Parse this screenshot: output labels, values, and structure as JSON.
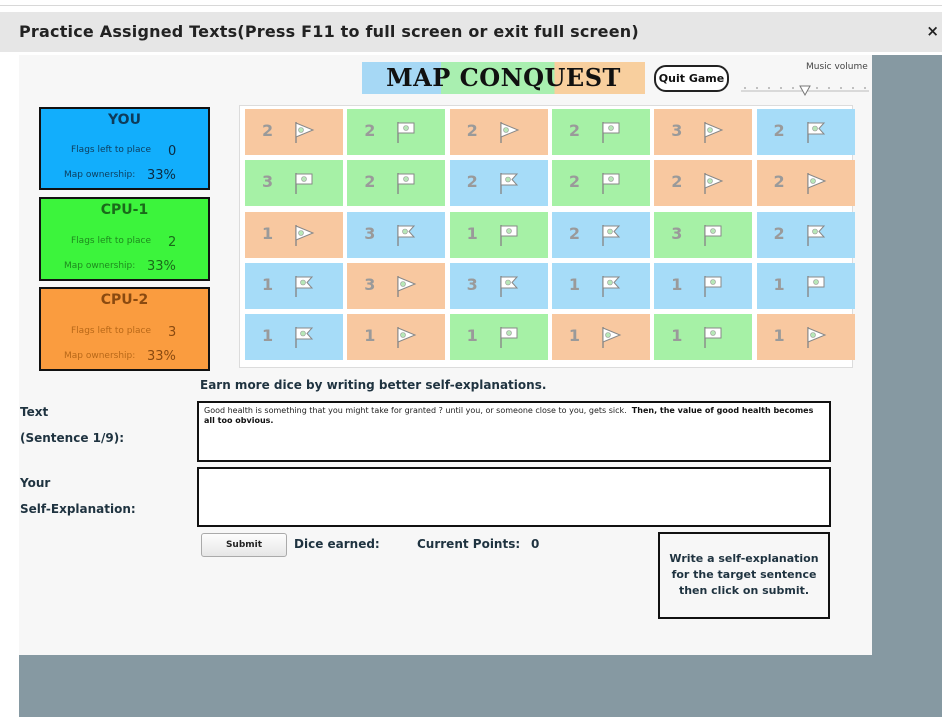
{
  "window": {
    "title": "Practice Assigned Texts(Press F11 to full screen or exit full screen)",
    "close_label": "×"
  },
  "header": {
    "logo_text": "MAP CONQUEST",
    "quit_label": "Quit Game",
    "music_label": "Music volume",
    "music_level": 0.5
  },
  "players": [
    {
      "name": "YOU",
      "flags_label": "Flags left to place",
      "flags": "0",
      "ownership_label": "Map ownership:",
      "ownership": "33%"
    },
    {
      "name": "CPU-1",
      "flags_label": "Flags left to place",
      "flags": "2",
      "ownership_label": "Map ownership:",
      "ownership": "33%"
    },
    {
      "name": "CPU-2",
      "flags_label": "Flags left to place",
      "flags": "3",
      "ownership_label": "Map ownership:",
      "ownership": "33%"
    }
  ],
  "colors": {
    "you": "#12aefc",
    "cpu1": "#3cf43c",
    "cpu2": "#fa9c3f",
    "tile_you": "#a6dcf8",
    "tile_cpu1": "#a6f1a6",
    "tile_cpu2": "#f8c8a0"
  },
  "map": {
    "rows": [
      [
        {
          "owner": "cpu2",
          "dice": "2",
          "flag": "pennant"
        },
        {
          "owner": "cpu1",
          "dice": "2",
          "flag": "square"
        },
        {
          "owner": "cpu2",
          "dice": "2",
          "flag": "pennant"
        },
        {
          "owner": "cpu1",
          "dice": "2",
          "flag": "square"
        },
        {
          "owner": "cpu2",
          "dice": "3",
          "flag": "pennant"
        },
        {
          "owner": "you",
          "dice": "2",
          "flag": "swallowtail"
        }
      ],
      [
        {
          "owner": "cpu1",
          "dice": "3",
          "flag": "square"
        },
        {
          "owner": "cpu1",
          "dice": "2",
          "flag": "square"
        },
        {
          "owner": "you",
          "dice": "2",
          "flag": "swallowtail"
        },
        {
          "owner": "cpu1",
          "dice": "2",
          "flag": "square"
        },
        {
          "owner": "cpu2",
          "dice": "2",
          "flag": "pennant"
        },
        {
          "owner": "cpu2",
          "dice": "2",
          "flag": "pennant"
        }
      ],
      [
        {
          "owner": "cpu2",
          "dice": "1",
          "flag": "pennant"
        },
        {
          "owner": "you",
          "dice": "3",
          "flag": "swallowtail"
        },
        {
          "owner": "cpu1",
          "dice": "1",
          "flag": "square"
        },
        {
          "owner": "you",
          "dice": "2",
          "flag": "swallowtail"
        },
        {
          "owner": "cpu1",
          "dice": "3",
          "flag": "square"
        },
        {
          "owner": "you",
          "dice": "2",
          "flag": "swallowtail"
        }
      ],
      [
        {
          "owner": "you",
          "dice": "1",
          "flag": "swallowtail"
        },
        {
          "owner": "cpu2",
          "dice": "3",
          "flag": "pennant"
        },
        {
          "owner": "you",
          "dice": "3",
          "flag": "swallowtail"
        },
        {
          "owner": "you",
          "dice": "1",
          "flag": "swallowtail"
        },
        {
          "owner": "you",
          "dice": "1",
          "flag": "square"
        },
        {
          "owner": "you",
          "dice": "1",
          "flag": "square"
        }
      ],
      [
        {
          "owner": "you",
          "dice": "1",
          "flag": "swallowtail"
        },
        {
          "owner": "cpu2",
          "dice": "1",
          "flag": "pennant"
        },
        {
          "owner": "cpu1",
          "dice": "1",
          "flag": "square"
        },
        {
          "owner": "cpu2",
          "dice": "1",
          "flag": "pennant"
        },
        {
          "owner": "cpu1",
          "dice": "1",
          "flag": "square"
        },
        {
          "owner": "cpu2",
          "dice": "1",
          "flag": "pennant"
        }
      ]
    ]
  },
  "content": {
    "prompt": "Earn more dice by writing better self-explanations.",
    "text_label_1": "Text",
    "text_label_2": "(Sentence 1/9):",
    "sentence_plain": "Good health is something that you might take for granted ? until you, or someone close to you, gets sick.",
    "sentence_bold": "Then, the value of good health becomes all too obvious.",
    "explain_label_1": "Your",
    "explain_label_2": "Self-Explanation:",
    "explain_value": "",
    "submit_label": "Submit",
    "dice_label": "Dice earned:",
    "points_label": "Current Points:",
    "points_value": "0",
    "hint": "Write a self-explanation for the target sentence then click on submit."
  }
}
